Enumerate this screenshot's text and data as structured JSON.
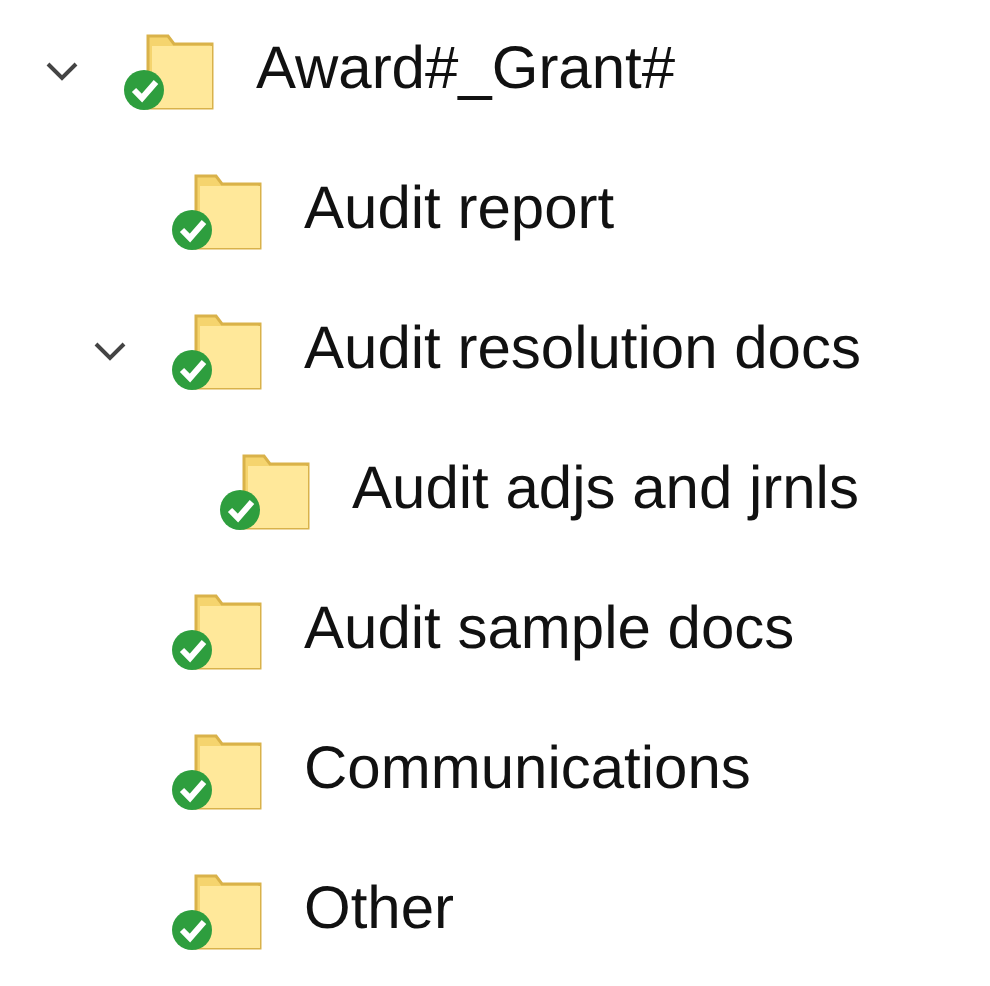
{
  "tree": [
    {
      "label": "Award#_Grant#",
      "expanded": true,
      "children": [
        {
          "label": "Audit report"
        },
        {
          "label": "Audit resolution docs",
          "expanded": true,
          "children": [
            {
              "label": "Audit adjs and jrnls"
            }
          ]
        },
        {
          "label": "Audit sample docs"
        },
        {
          "label": "Communications"
        },
        {
          "label": "Other"
        }
      ]
    }
  ]
}
